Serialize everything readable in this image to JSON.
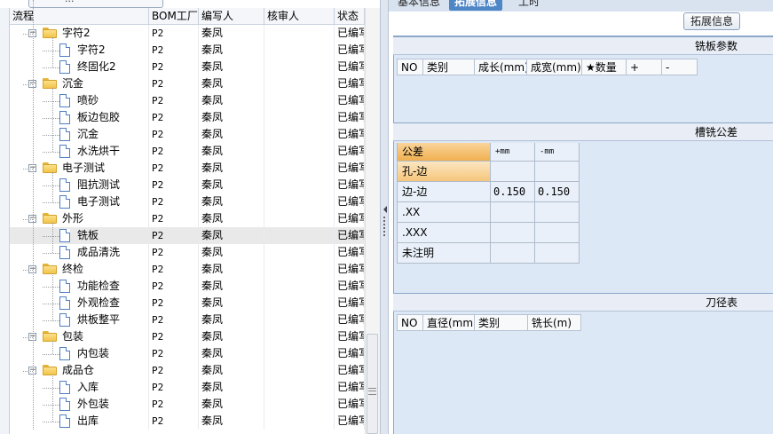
{
  "left": {
    "top_button_label": "...",
    "columns": [
      "流程",
      "BOM工厂",
      "编写人",
      "核审人",
      "状态"
    ],
    "rows": [
      {
        "name": "字符2",
        "type": "folder",
        "bom": "P2",
        "writer": "秦凤",
        "reviewer": "",
        "status": "已编写"
      },
      {
        "name": "字符2",
        "type": "doc",
        "bom": "P2",
        "writer": "秦凤",
        "reviewer": "",
        "status": "已编写"
      },
      {
        "name": "终固化2",
        "type": "doc",
        "bom": "P2",
        "writer": "秦凤",
        "reviewer": "",
        "status": "已编写"
      },
      {
        "name": "沉金",
        "type": "folder",
        "bom": "P2",
        "writer": "秦凤",
        "reviewer": "",
        "status": "已编写"
      },
      {
        "name": "喷砂",
        "type": "doc",
        "bom": "P2",
        "writer": "秦凤",
        "reviewer": "",
        "status": "已编写"
      },
      {
        "name": "板边包胶",
        "type": "doc",
        "bom": "P2",
        "writer": "秦凤",
        "reviewer": "",
        "status": "已编写"
      },
      {
        "name": "沉金",
        "type": "doc",
        "bom": "P2",
        "writer": "秦凤",
        "reviewer": "",
        "status": "已编写"
      },
      {
        "name": "水洗烘干",
        "type": "doc",
        "bom": "P2",
        "writer": "秦凤",
        "reviewer": "",
        "status": "已编写"
      },
      {
        "name": "电子测试",
        "type": "folder",
        "bom": "P2",
        "writer": "秦凤",
        "reviewer": "",
        "status": "已编写"
      },
      {
        "name": "阻抗测试",
        "type": "doc",
        "bom": "P2",
        "writer": "秦凤",
        "reviewer": "",
        "status": "已编写"
      },
      {
        "name": "电子测试",
        "type": "doc",
        "bom": "P2",
        "writer": "秦凤",
        "reviewer": "",
        "status": "已编写"
      },
      {
        "name": "外形",
        "type": "folder",
        "bom": "P2",
        "writer": "秦凤",
        "reviewer": "",
        "status": "已编写"
      },
      {
        "name": "铣板",
        "type": "doc",
        "bom": "P2",
        "writer": "秦凤",
        "reviewer": "",
        "status": "已编写",
        "selected": true
      },
      {
        "name": "成品清洗",
        "type": "doc",
        "bom": "P2",
        "writer": "秦凤",
        "reviewer": "",
        "status": "已编写"
      },
      {
        "name": "终检",
        "type": "folder",
        "bom": "P2",
        "writer": "秦凤",
        "reviewer": "",
        "status": "已编写"
      },
      {
        "name": "功能检查",
        "type": "doc",
        "bom": "P2",
        "writer": "秦凤",
        "reviewer": "",
        "status": "已编写"
      },
      {
        "name": "外观检查",
        "type": "doc",
        "bom": "P2",
        "writer": "秦凤",
        "reviewer": "",
        "status": "已编写"
      },
      {
        "name": "烘板整平",
        "type": "doc",
        "bom": "P2",
        "writer": "秦凤",
        "reviewer": "",
        "status": "已编写"
      },
      {
        "name": "包装",
        "type": "folder",
        "bom": "P2",
        "writer": "秦凤",
        "reviewer": "",
        "status": "已编写"
      },
      {
        "name": "内包装",
        "type": "doc",
        "bom": "P2",
        "writer": "秦凤",
        "reviewer": "",
        "status": "已编写"
      },
      {
        "name": "成品仓",
        "type": "folder",
        "bom": "P2",
        "writer": "秦凤",
        "reviewer": "",
        "status": "已编写"
      },
      {
        "name": "入库",
        "type": "doc",
        "bom": "P2",
        "writer": "秦凤",
        "reviewer": "",
        "status": "已编写"
      },
      {
        "name": "外包装",
        "type": "doc",
        "bom": "P2",
        "writer": "秦凤",
        "reviewer": "",
        "status": "已编写"
      },
      {
        "name": "出库",
        "type": "doc",
        "bom": "P2",
        "writer": "秦凤",
        "reviewer": "",
        "status": "已编写"
      }
    ]
  },
  "right": {
    "tabs": [
      {
        "label": "基本信息",
        "active": false
      },
      {
        "label": "拓展信息",
        "active": true
      },
      {
        "label": "工时",
        "active": false
      }
    ],
    "ext_button": "拓展信息",
    "board_section": {
      "title": "铣板参数",
      "columns": [
        "NO",
        "类别",
        "成长(mm)",
        "成宽(mm)",
        "★数量",
        "+",
        "-"
      ]
    },
    "tolerance_section": {
      "title": "槽铣公差",
      "columns": [
        "公差",
        "+mm",
        "-mm"
      ],
      "rows": [
        {
          "label": "孔-边",
          "plus": "",
          "minus": ""
        },
        {
          "label": "边-边",
          "plus": "0.150",
          "minus": "0.150"
        },
        {
          "label": ".XX",
          "plus": "",
          "minus": ""
        },
        {
          "label": ".XXX",
          "plus": "",
          "minus": ""
        },
        {
          "label": "未注明",
          "plus": "",
          "minus": ""
        }
      ]
    },
    "tool_section": {
      "title": "刀径表",
      "columns": [
        "NO",
        "直径(mm)",
        "类别",
        "铣长(m)"
      ]
    }
  },
  "colors": {
    "tab_active": "#4f86c6",
    "panel_bg": "#dde8f6",
    "highlight_orange": "#f0b050",
    "folder_yellow": "#f2c44a"
  }
}
